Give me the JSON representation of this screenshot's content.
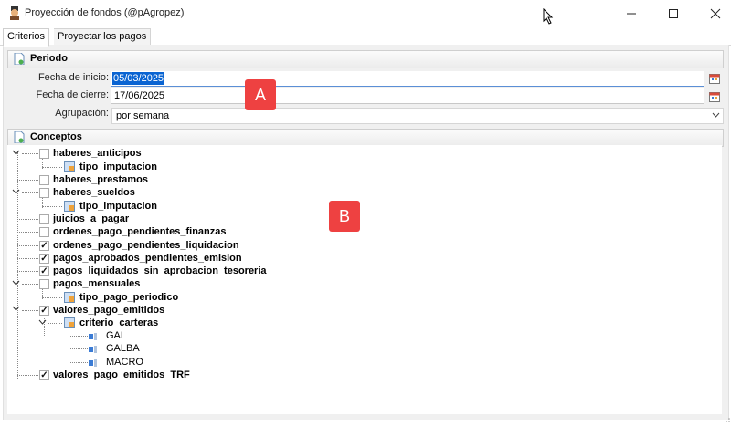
{
  "window": {
    "title": "Proyección de fondos (@pAgropez)"
  },
  "tabs": [
    "Criterios",
    "Proyectar los pagos"
  ],
  "periodo": {
    "header": "Periodo",
    "fecha_inicio_label": "Fecha de inicio:",
    "fecha_inicio": "05/03/2025",
    "fecha_cierre_label": "Fecha de cierre:",
    "fecha_cierre": "17/06/2025",
    "agrupacion_label": "Agrupación:",
    "agrupacion": "por semana"
  },
  "conceptos": {
    "header": "Conceptos",
    "tree": [
      {
        "label": "haberes_anticipos",
        "checked": false,
        "expanded": true
      },
      {
        "label": "tipo_imputacion"
      },
      {
        "label": "haberes_prestamos",
        "checked": false
      },
      {
        "label": "haberes_sueldos",
        "checked": false,
        "expanded": true
      },
      {
        "label": "tipo_imputacion"
      },
      {
        "label": "juicios_a_pagar",
        "checked": false
      },
      {
        "label": "ordenes_pago_pendientes_finanzas",
        "checked": false
      },
      {
        "label": "ordenes_pago_pendientes_liquidacion",
        "checked": true
      },
      {
        "label": "pagos_aprobados_pendientes_emision",
        "checked": true
      },
      {
        "label": "pagos_liquidados_sin_aprobacion_tesoreria",
        "checked": true
      },
      {
        "label": "pagos_mensuales",
        "checked": false,
        "expanded": true
      },
      {
        "label": "tipo_pago_periodico"
      },
      {
        "label": "valores_pago_emitidos",
        "checked": true,
        "expanded": true
      },
      {
        "label": "criterio_carteras",
        "expanded": true
      },
      {
        "label": "GAL"
      },
      {
        "label": "GALBA"
      },
      {
        "label": "MACRO"
      },
      {
        "label": "valores_pago_emitidos_TRF",
        "checked": true
      }
    ]
  },
  "markers": [
    "A",
    "B"
  ]
}
